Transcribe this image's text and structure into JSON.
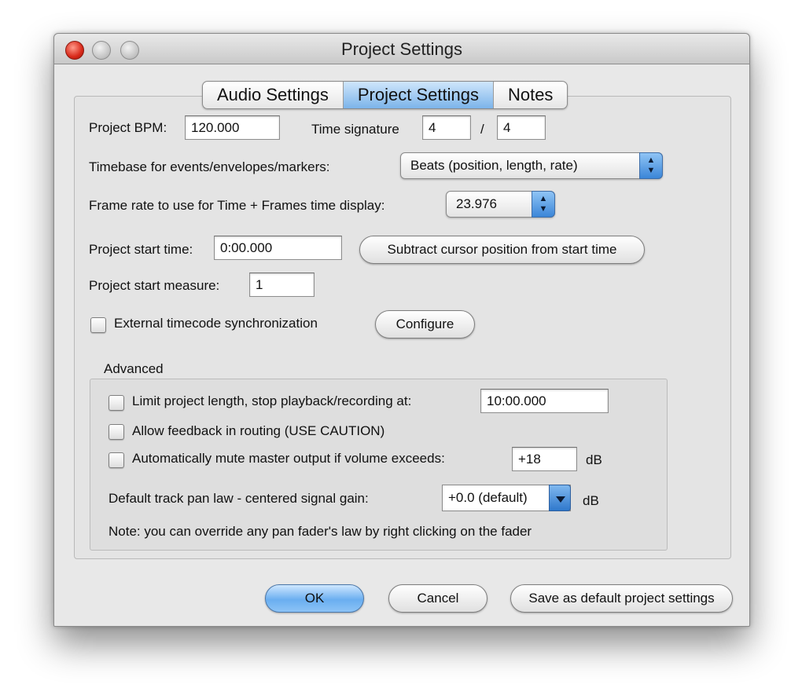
{
  "window": {
    "title": "Project Settings"
  },
  "tabs": [
    {
      "label": "Audio Settings",
      "active": false
    },
    {
      "label": "Project Settings",
      "active": true
    },
    {
      "label": "Notes",
      "active": false
    }
  ],
  "bpm": {
    "label": "Project BPM:",
    "value": "120.000"
  },
  "time_signature": {
    "label": "Time signature",
    "numerator": "4",
    "separator": "/",
    "denominator": "4"
  },
  "timebase": {
    "label": "Timebase for events/envelopes/markers:",
    "value": "Beats (position, length, rate)"
  },
  "frame_rate": {
    "label": "Frame rate to use for Time + Frames time display:",
    "value": "23.976"
  },
  "start_time": {
    "label": "Project start time:",
    "value": "0:00.000",
    "subtract_button": "Subtract cursor position from start time"
  },
  "start_measure": {
    "label": "Project start measure:",
    "value": "1"
  },
  "timecode": {
    "label": "External timecode synchronization",
    "checked": false,
    "configure_button": "Configure"
  },
  "advanced": {
    "title": "Advanced",
    "limit_length": {
      "label": "Limit project length, stop playback/recording at:",
      "checked": false,
      "value": "10:00.000"
    },
    "feedback": {
      "label": "Allow feedback in routing (USE CAUTION)",
      "checked": false
    },
    "auto_mute": {
      "label": "Automatically mute master output if volume exceeds:",
      "checked": false,
      "value": "+18",
      "unit": "dB"
    },
    "pan_law": {
      "label": "Default track pan law - centered signal gain:",
      "value": "+0.0 (default)",
      "unit": "dB"
    },
    "note": "Note: you can override any pan fader's law by right clicking on the fader"
  },
  "buttons": {
    "ok": "OK",
    "cancel": "Cancel",
    "save_default": "Save as default project settings"
  },
  "colors": {
    "accent": "#6aaef0",
    "close": "#d8291a"
  }
}
